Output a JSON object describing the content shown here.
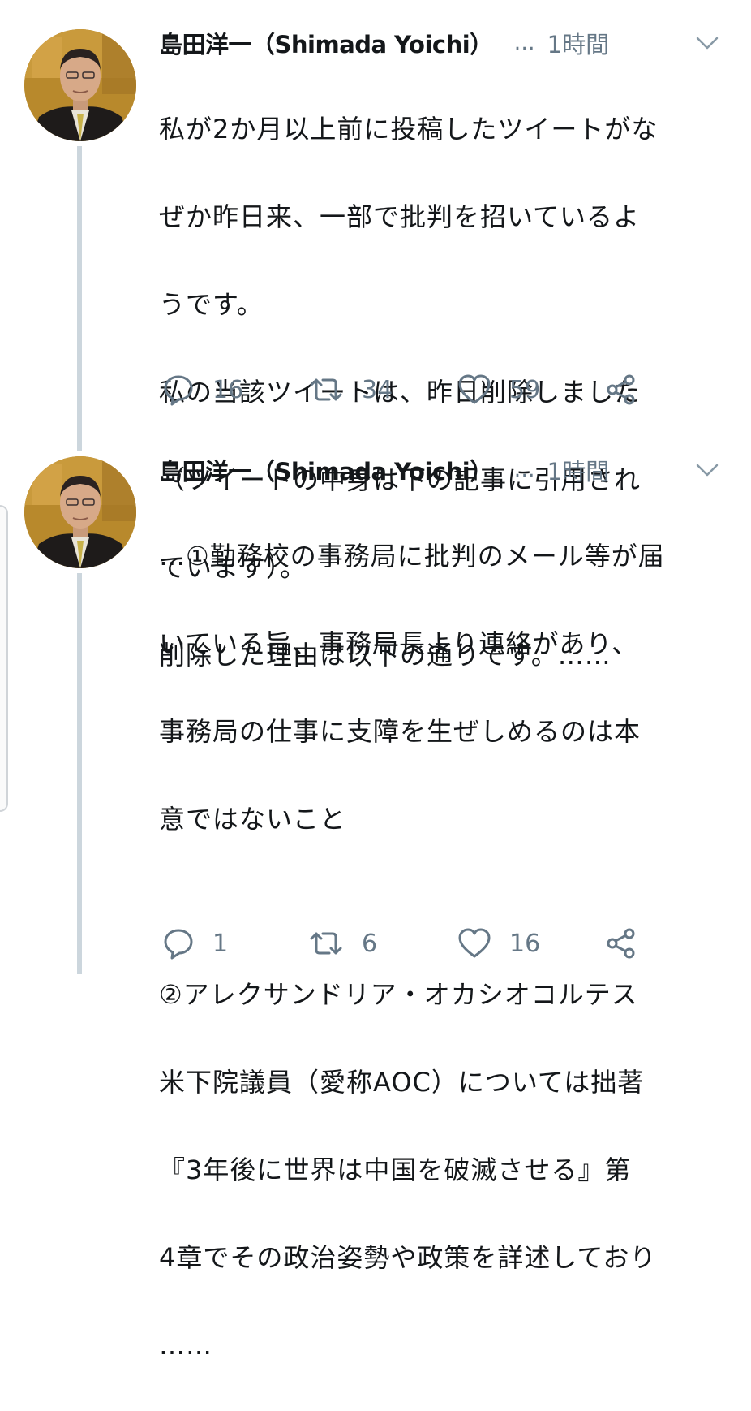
{
  "tweets": [
    {
      "author": "島田洋一（Shimada Yoichi）",
      "more": "…",
      "time": "1時間",
      "avatar_icon": "profile-photo-man-in-suit",
      "text": "私が2か月以上前に投稿したツイートがなぜか昨日来、一部で批判を招いているようです。\n私の当該ツイートは、昨日削除しました（ツイートの中身は下の記事に引用されています）。\n削除した理由は以下の通りです。……",
      "lines": [
        "私が2か月以上前に投稿したツイートがな",
        "ぜか昨日来、一部で批判を招いているよ",
        "うです。",
        "私の当該ツイートは、昨日削除しました",
        "（ツイートの中身は下の記事に引用され",
        "ています）。",
        "削除した理由は以下の通りです。……"
      ],
      "replies": "16",
      "retweets": "34",
      "likes": "59"
    },
    {
      "author": "島田洋一（Shimada Yoichi）",
      "more": "…",
      "time": "1時間",
      "avatar_icon": "profile-photo-man-in-suit",
      "lines": [
        "…①勤務校の事務局に批判のメール等が届",
        "いている旨、事務局長より連絡があり、",
        "事務局の仕事に支障を生ぜしめるのは本",
        "意ではないこと",
        "",
        "②アレクサンドリア・オカシオコルテス",
        "米下院議員（愛称AOC）については拙著",
        "『3年後に世界は中国を破滅させる』第",
        "4章でその政治姿勢や政策を詳述しており",
        "……"
      ],
      "replies": "1",
      "retweets": "6",
      "likes": "16"
    }
  ],
  "icons": {
    "reply": "reply-icon",
    "retweet": "retweet-icon",
    "like": "heart-icon",
    "share": "share-icon",
    "menu": "chevron-down-icon"
  },
  "colors": {
    "text": "#14171a",
    "secondary": "#657786",
    "thread_line": "#ccd6dd"
  }
}
